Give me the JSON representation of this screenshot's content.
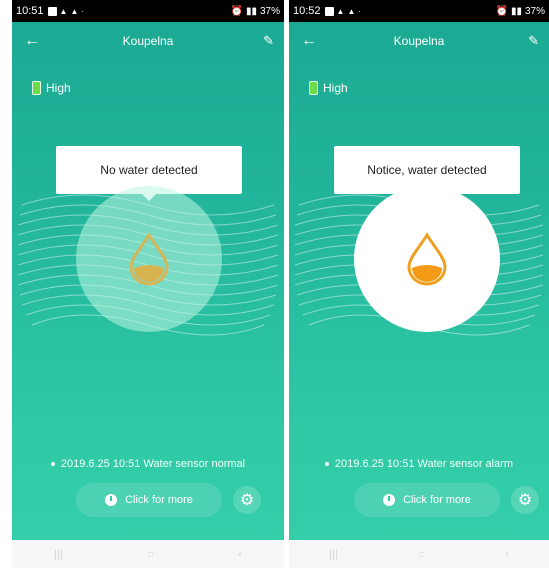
{
  "screens": [
    {
      "status": {
        "time": "10:51",
        "battery_text": "37%"
      },
      "room": "Koupelna",
      "battery_level": "High",
      "state_message": "No water detected",
      "last_event": "2019.6.25 10:51 Water sensor normal",
      "more_label": "Click for more",
      "drop_color": "#d7b65a",
      "drop_fill": "#d8b450"
    },
    {
      "status": {
        "time": "10:52",
        "battery_text": "37%"
      },
      "room": "Koupelna",
      "battery_level": "High",
      "state_message": "Notice, water detected",
      "last_event": "2019.6.25 10:51 Water sensor alarm",
      "more_label": "Click for more",
      "drop_color": "#f0a020",
      "drop_fill": "#f39a16"
    }
  ],
  "icons": [
    "back-arrow-icon",
    "edit-pencil-icon",
    "battery-icon",
    "water-drop-icon",
    "clock-icon",
    "gear-icon"
  ]
}
